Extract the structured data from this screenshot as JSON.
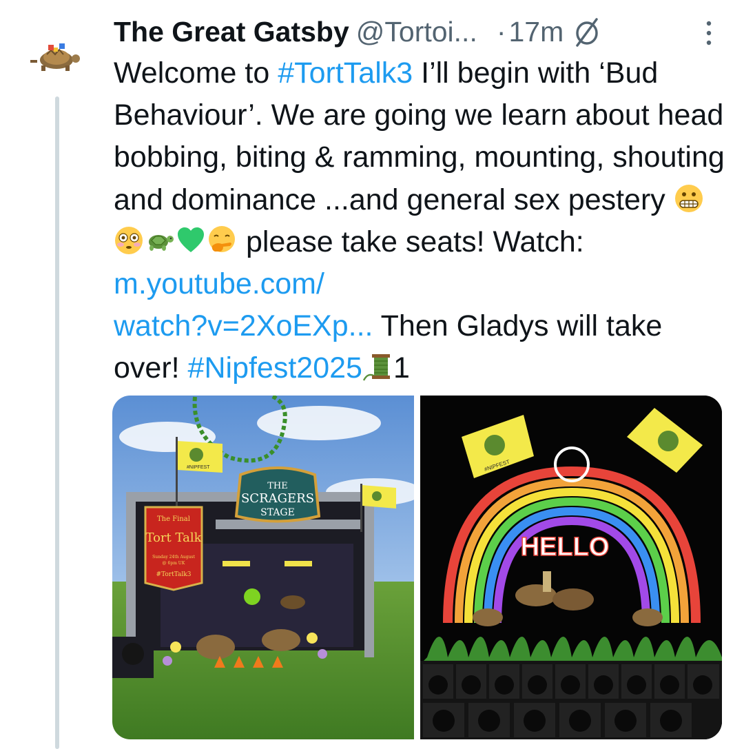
{
  "tweet": {
    "author_name": "The Great Gatsby",
    "author_handle": "@Tortoi...",
    "separator": "·",
    "timestamp": "17m",
    "segments": [
      {
        "text": "Welcome to ",
        "type": "text"
      },
      {
        "text": "#TortTalk3",
        "type": "hashtag"
      },
      {
        "text": " I’ll begin with ‘Bud Behaviour’. We are going we learn about head bobbing, biting & ramming, mounting, shouting and dominance ...and general sex pestery ",
        "type": "text"
      },
      {
        "text": " please take seats! Watch: ",
        "type": "text"
      },
      {
        "text": "m.youtube.com/\nwatch?v=2XoEXp...",
        "type": "link"
      },
      {
        "text": " Then Gladys will take over! ",
        "type": "text"
      },
      {
        "text": "#Nipfest2025",
        "type": "hashtag"
      },
      {
        "text": "1",
        "type": "text"
      }
    ],
    "emojis_after_pestery": [
      "grimacing-face-emoji",
      "flushed-face-emoji",
      "turtle-emoji",
      "green-heart-emoji",
      "hand-over-mouth-emoji"
    ],
    "emoji_after_hashtag": "spool-of-thread-emoji"
  },
  "media": {
    "left_image": {
      "stage_sign": [
        "THE",
        "SCRAGERS",
        "STAGE"
      ],
      "banner": [
        "The Final",
        "Tort Talk",
        "Sunday 24th August",
        "@ 6pm UK",
        "#TortTalk3"
      ],
      "flag_text": "#NIPFEST"
    },
    "right_image": {
      "hello_text": "HELLO",
      "flag_text": "#NIPFEST"
    }
  },
  "colors": {
    "link": "#1d9bf0",
    "text": "#0f1419",
    "secondary": "#536471",
    "thread_line": "#cfd9de"
  }
}
